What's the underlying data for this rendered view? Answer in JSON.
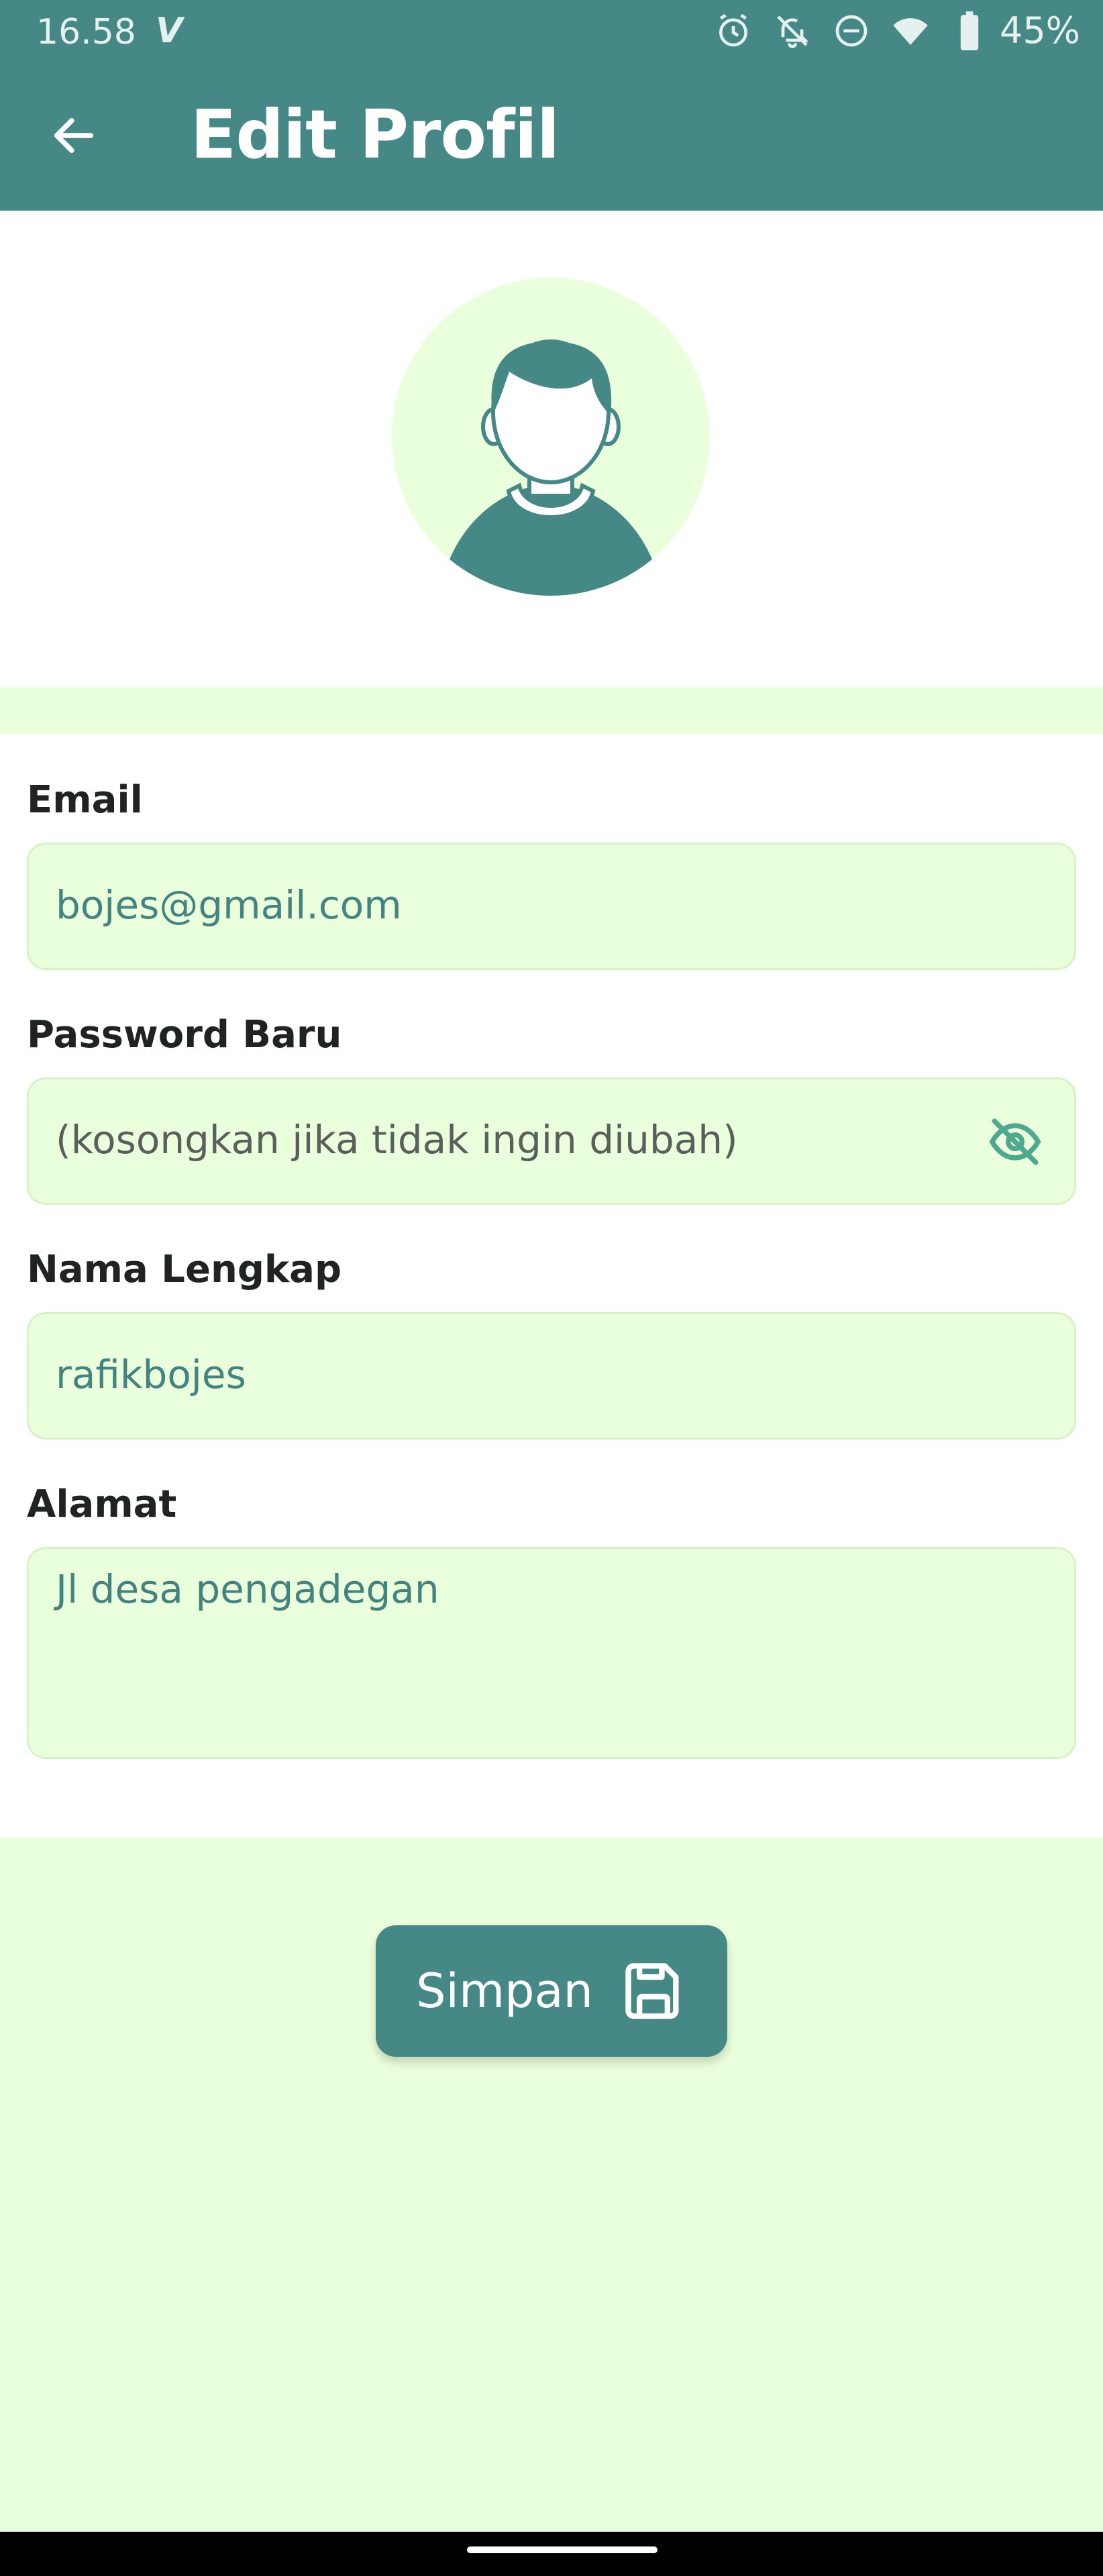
{
  "status_bar": {
    "time": "16.58",
    "carrier_mark": "V",
    "battery": "45%",
    "icons": [
      "alarm-icon",
      "notifications-off-icon",
      "do-not-disturb-icon",
      "wifi-icon",
      "battery-icon"
    ]
  },
  "toolbar": {
    "back_icon": "arrow-back-icon",
    "title": "Edit Profil"
  },
  "avatar": {
    "icon": "user-avatar-icon"
  },
  "form": {
    "email": {
      "label": "Email",
      "value": "bojes@gmail.com"
    },
    "password": {
      "label": "Password Baru",
      "value": "",
      "placeholder": "(kosongkan jika tidak ingin diubah)",
      "toggle_icon": "visibility-off-icon"
    },
    "full_name": {
      "label": "Nama Lengkap",
      "value": "rafikbojes"
    },
    "address": {
      "label": "Alamat",
      "value": "Jl desa pengadegan"
    }
  },
  "actions": {
    "save_label": "Simpan",
    "save_icon": "save-icon"
  },
  "colors": {
    "primary": "#458886",
    "background": "#eaffdc",
    "field_text": "#44837f",
    "eye_icon": "#4fa88f"
  }
}
